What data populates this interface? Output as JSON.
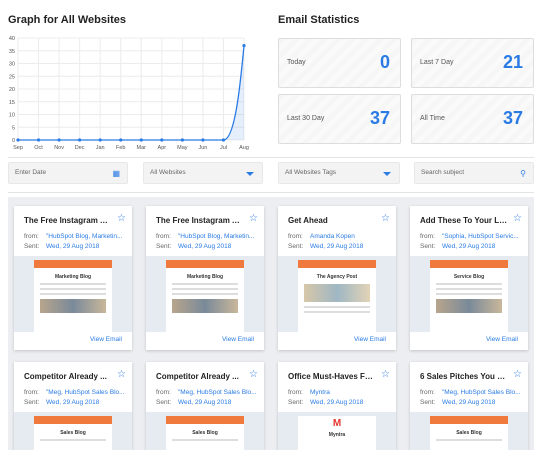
{
  "graph": {
    "title": "Graph for All Websites"
  },
  "chart_data": {
    "type": "line",
    "categories": [
      "Sep",
      "Oct",
      "Nov",
      "Dec",
      "Jan",
      "Feb",
      "Mar",
      "Apr",
      "May",
      "Jun",
      "Jul",
      "Aug"
    ],
    "values": [
      0,
      0,
      0,
      0,
      0,
      0,
      0,
      0,
      0,
      0,
      0,
      37
    ],
    "ylim": [
      0,
      40
    ],
    "yticks": [
      "0",
      "5",
      "10",
      "15",
      "20",
      "25",
      "30",
      "35",
      "40"
    ],
    "grid": true,
    "color": "#2a7be4"
  },
  "stats": {
    "title": "Email Statistics",
    "items": [
      {
        "label": "Today",
        "value": "0"
      },
      {
        "label": "Last 7 Day",
        "value": "21"
      },
      {
        "label": "Last 30 Day",
        "value": "37"
      },
      {
        "label": "All Time",
        "value": "37"
      }
    ]
  },
  "filters": {
    "date_placeholder": "Enter Date",
    "websites": "All Websites",
    "tags": "All Websites Tags",
    "search_placeholder": "Search subject"
  },
  "cards": [
    {
      "title": "The Free Instagram A...",
      "from_label": "from:",
      "from": "\"HubSpot Blog, Marketin...",
      "sent_label": "Sent:",
      "sent": "Wed, 29 Aug 2018",
      "preview_title": "Marketing Blog",
      "view": "View Email"
    },
    {
      "title": "The Free Instagram A...",
      "from_label": "from:",
      "from": "\"HubSpot Blog, Marketin...",
      "sent_label": "Sent:",
      "sent": "Wed, 29 Aug 2018",
      "preview_title": "Marketing Blog",
      "view": "View Email"
    },
    {
      "title": "Get Ahead",
      "from_label": "from:",
      "from": "Amanda Kopen",
      "sent_label": "Sent:",
      "sent": "Wed, 29 Aug 2018",
      "preview_title": "The Agency Post",
      "view": "View Email"
    },
    {
      "title": "Add These To Your Lis...",
      "from_label": "from:",
      "from": "\"Sophia, HubSpot Servic...",
      "sent_label": "Sent:",
      "sent": "Wed, 29 Aug 2018",
      "preview_title": "Service Blog",
      "view": "View Email"
    },
    {
      "title": "Competitor Already ...",
      "from_label": "from:",
      "from": "\"Meg, HubSpot Sales Blo...",
      "sent_label": "Sent:",
      "sent": "Wed, 29 Aug 2018",
      "preview_title": "Sales Blog"
    },
    {
      "title": "Competitor Already ...",
      "from_label": "from:",
      "from": "\"Meg, HubSpot Sales Blo...",
      "sent_label": "Sent:",
      "sent": "Wed, 29 Aug 2018",
      "preview_title": "Sales Blog"
    },
    {
      "title": "Office Must-Haves Fo...",
      "from_label": "from:",
      "from": "Myntra",
      "sent_label": "Sent:",
      "sent": "Wed, 29 Aug 2018",
      "preview_title": "Myntra"
    },
    {
      "title": "6 Sales Pitches You N...",
      "from_label": "from:",
      "from": "\"Meg, HubSpot Sales Blo...",
      "sent_label": "Sent:",
      "sent": "Wed, 29 Aug 2018",
      "preview_title": "Sales Blog"
    }
  ]
}
